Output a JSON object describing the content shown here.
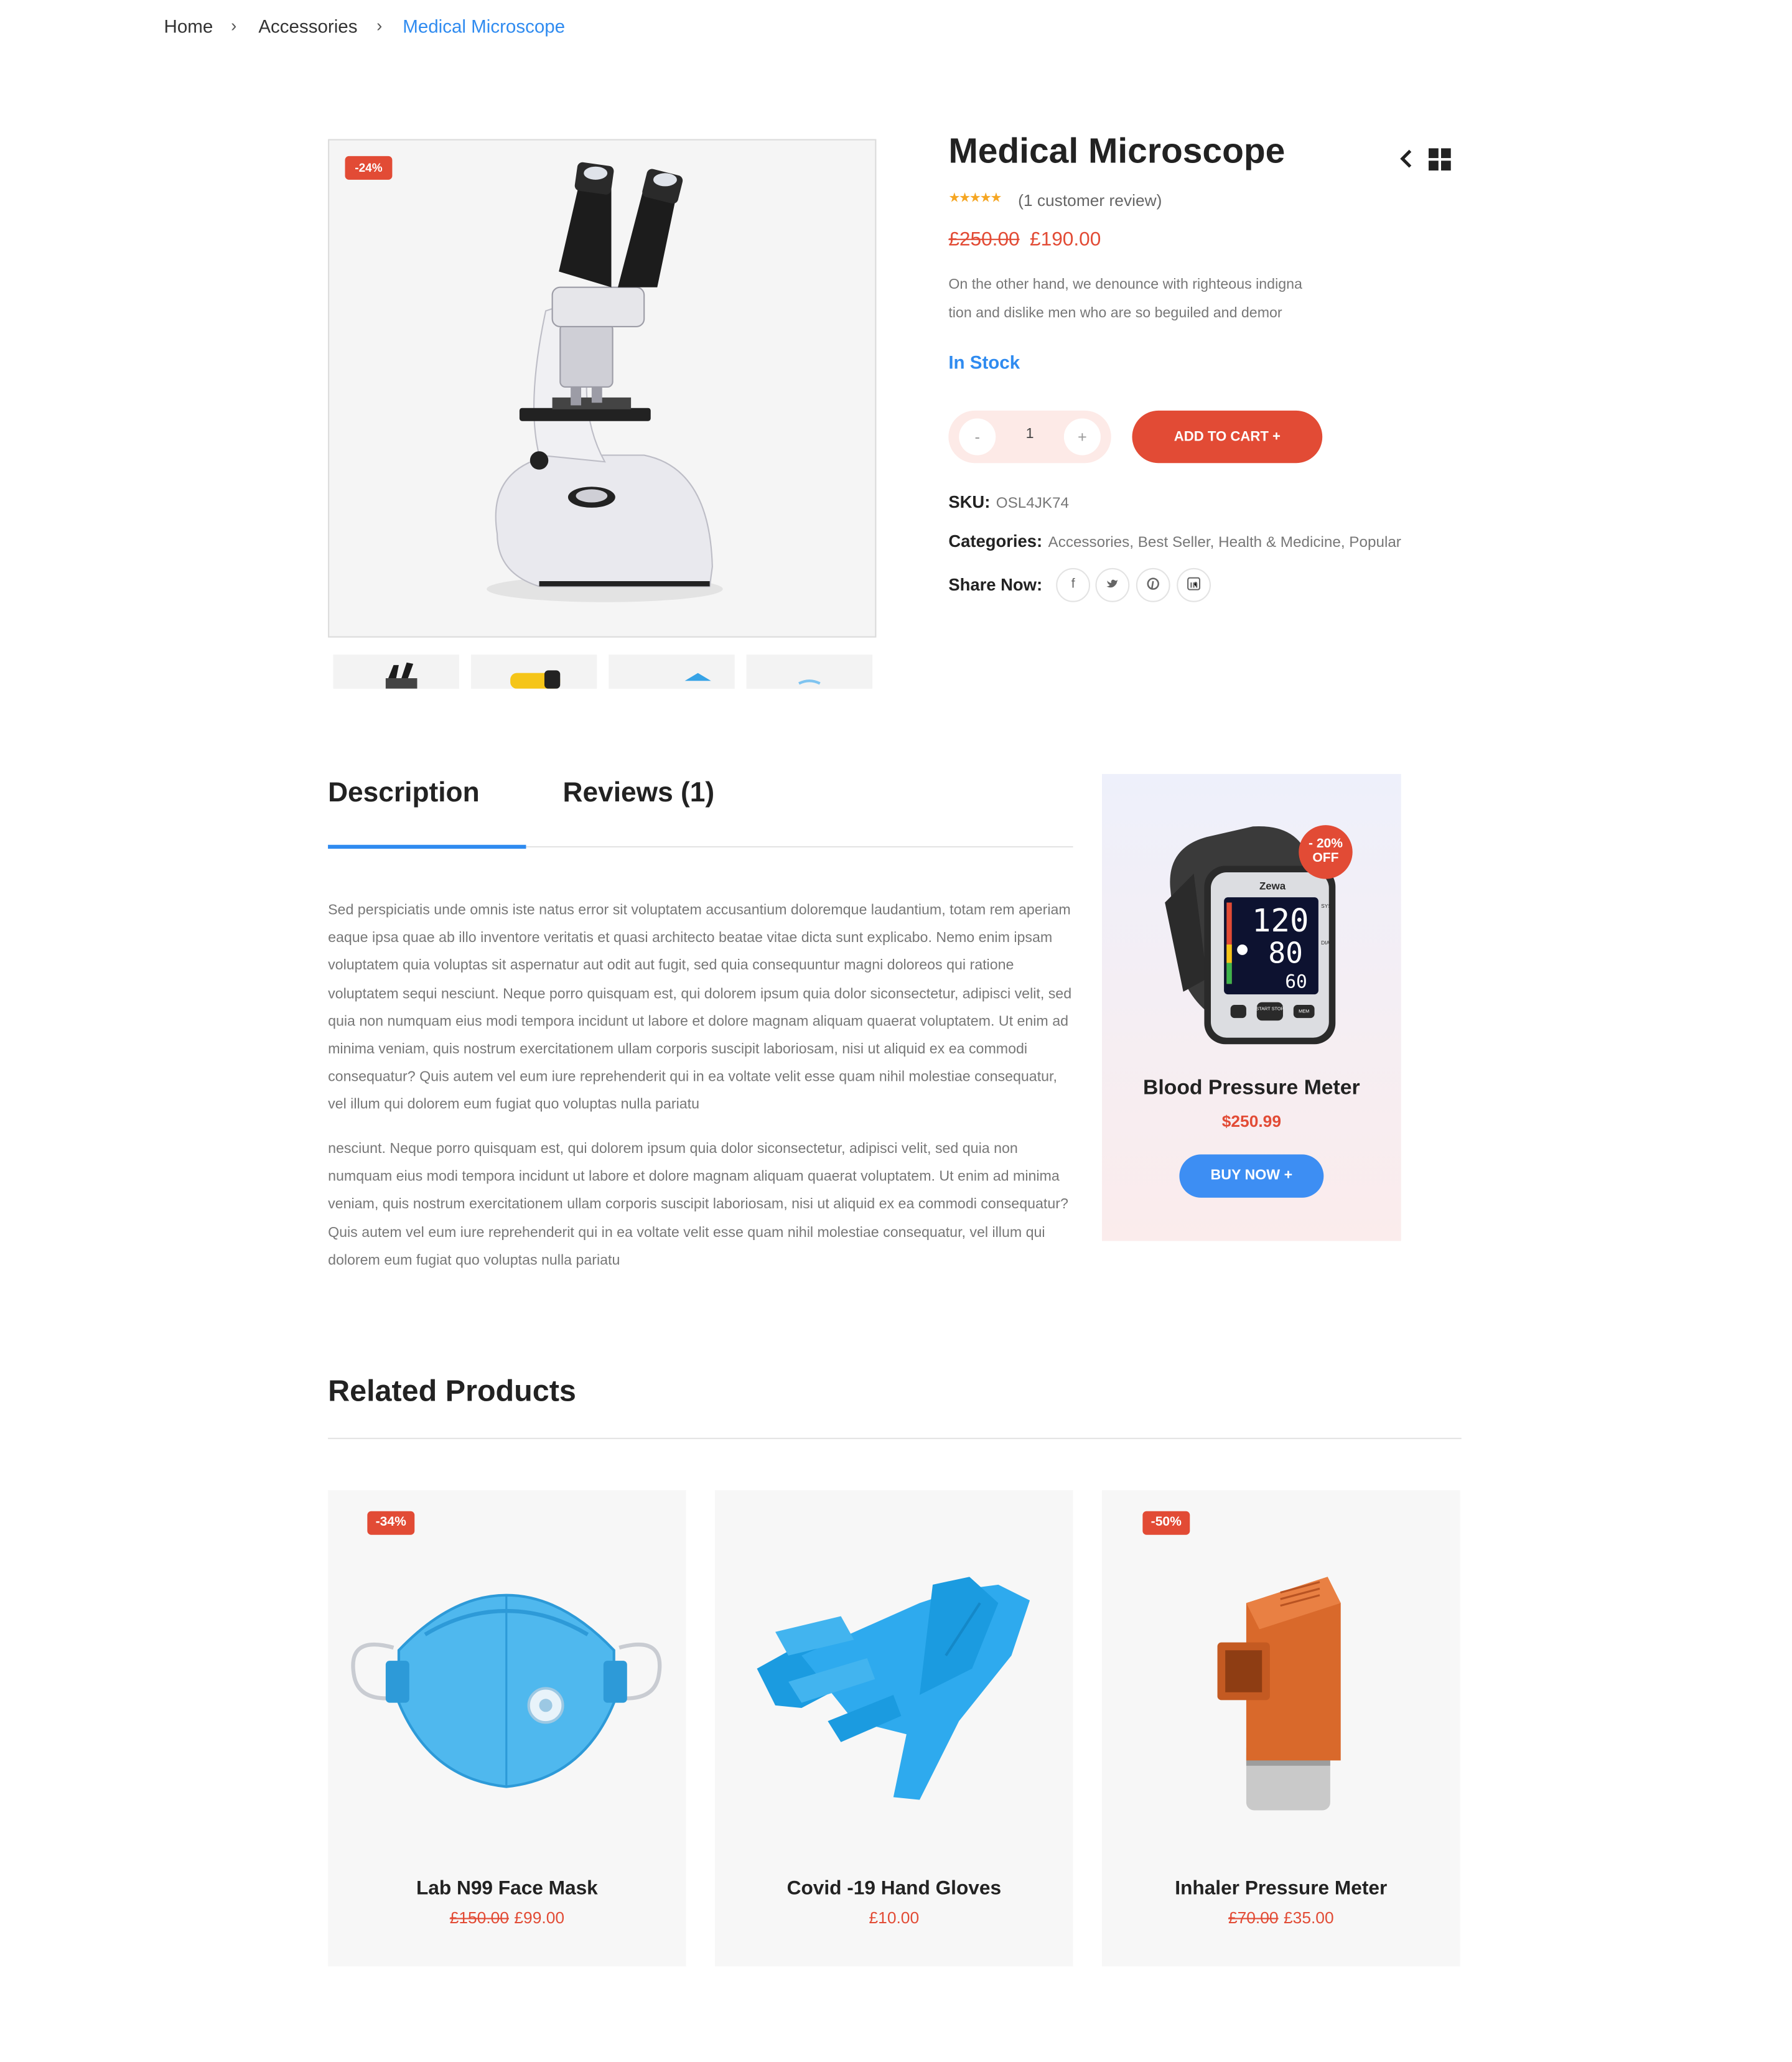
{
  "breadcrumb": {
    "home": "Home",
    "sep": "›",
    "category": "Accessories",
    "current": "Medical Microscope"
  },
  "product": {
    "title": "Medical Microscope",
    "discount_badge": "-24%",
    "stars": "★★★★★",
    "review_count": "(1 customer review)",
    "old_price": "£250.00",
    "new_price": "£190.00",
    "short_desc_line1": "On the other hand, we denounce with righteous indigna",
    "short_desc_line2": "tion and dislike men who are so beguiled and demor",
    "stock": "In Stock",
    "qty_minus": "-",
    "qty_value": "1",
    "qty_plus": "+",
    "add_to_cart": "ADD TO CART  +",
    "sku_label": "SKU:",
    "sku_value": "OSL4JK74",
    "categories_label": "Categories:",
    "categories_value": "Accessories, Best Seller, Health & Medicine, Popular",
    "share_label": "Share Now:",
    "share_icons": [
      "facebook-icon",
      "twitter-icon",
      "pinterest-icon",
      "linkedin-icon"
    ]
  },
  "tabs": {
    "description": "Description",
    "reviews": "Reviews (1)"
  },
  "description": {
    "para1": "Sed perspiciatis unde omnis iste natus error sit voluptatem accusantium doloremque laudantium, totam rem aperiam eaque ipsa quae ab illo inventore veritatis et quasi architecto beatae vitae dicta sunt explicabo. Nemo enim ipsam voluptatem quia voluptas sit aspernatur aut odit aut fugit, sed quia consequuntur magni doloreos qui ratione voluptatem sequi nesciunt. Neque porro quisquam est, qui dolorem ipsum quia dolor siconsectetur, adipisci velit, sed quia non numquam eius modi tempora incidunt ut labore et dolore magnam aliquam quaerat voluptatem. Ut enim ad minima veniam, quis nostrum exercitationem ullam corporis suscipit laboriosam, nisi ut aliquid ex ea commodi consequatur? Quis autem vel eum iure reprehenderit qui in ea voltate velit esse quam nihil molestiae consequatur, vel illum qui dolorem eum fugiat quo voluptas nulla pariatu",
    "para2": "nesciunt. Neque porro quisquam est, qui dolorem ipsum quia dolor siconsectetur, adipisci velit, sed quia non numquam eius modi tempora incidunt ut labore et dolore magnam aliquam quaerat voluptatem. Ut enim ad minima veniam, quis nostrum exercitationem ullam corporis suscipit laboriosam, nisi ut aliquid ex ea commodi consequatur? Quis autem vel eum iure reprehenderit qui in ea voltate velit esse quam nihil molestiae consequatur, vel illum qui dolorem eum fugiat quo voluptas nulla pariatu"
  },
  "promo": {
    "badge_line1": "- 20%",
    "badge_line2": "OFF",
    "title": "Blood Pressure Meter",
    "price": "$250.99",
    "button": "BUY NOW  +",
    "device_brand": "Zewa",
    "reading_sys": "120",
    "reading_dia": "80",
    "reading_pulse": "60",
    "label_sys": "SYS.",
    "label_dia": "DIA.",
    "btn_start": "START STOP",
    "btn_mem": "MEM"
  },
  "related": {
    "title": "Related Products",
    "items": [
      {
        "name": "Lab N99 Face Mask",
        "old_price": "£150.00",
        "price": "£99.00",
        "badge": "-34%"
      },
      {
        "name": "Covid -19 Hand Gloves",
        "old_price": "",
        "price": "£10.00",
        "badge": ""
      },
      {
        "name": "Inhaler Pressure Meter",
        "old_price": "£70.00",
        "price": "£35.00",
        "badge": "-50%"
      }
    ]
  },
  "colors": {
    "accent_blue": "#2f8bf0",
    "accent_red": "#e24b35",
    "buy_blue": "#3d8ef3"
  }
}
